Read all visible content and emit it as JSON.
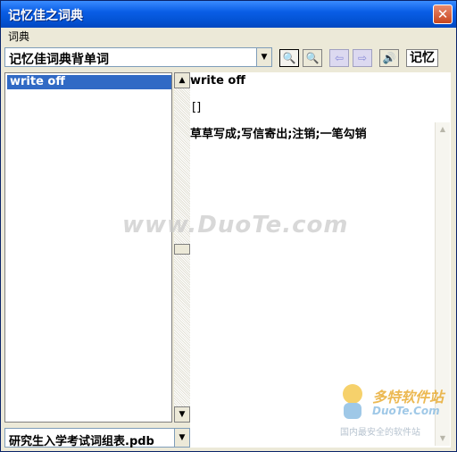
{
  "window": {
    "title": "记忆佳之词典",
    "close_glyph": "✕"
  },
  "menu": {
    "items": [
      "词典"
    ]
  },
  "toolbar": {
    "dictionary_select": "记忆佳词典背单词",
    "buttons": [
      {
        "name": "search",
        "glyph": "🔍"
      },
      {
        "name": "search-add",
        "glyph": "🔍"
      },
      {
        "name": "previous",
        "glyph": "⇦"
      },
      {
        "name": "next",
        "glyph": "⇨"
      },
      {
        "name": "speaker",
        "glyph": "🔊"
      }
    ],
    "memory_button": "记忆"
  },
  "word_list": {
    "items": [
      "write off"
    ]
  },
  "entry": {
    "headword": "write off",
    "phonetic": "[]",
    "definition": "草草写成;写信寄出;注销;一笔勾销"
  },
  "wordbook_select": "研究生入学考试词组表.pdb",
  "watermark": "www.DuoTe.com",
  "logo": {
    "title": "多特软件站",
    "url": "DuoTe.Com",
    "slogan": "国内最安全的软件站"
  },
  "colors": {
    "title_bar": "#0454d6",
    "selection": "#316ac5",
    "close_button": "#c8461e"
  }
}
